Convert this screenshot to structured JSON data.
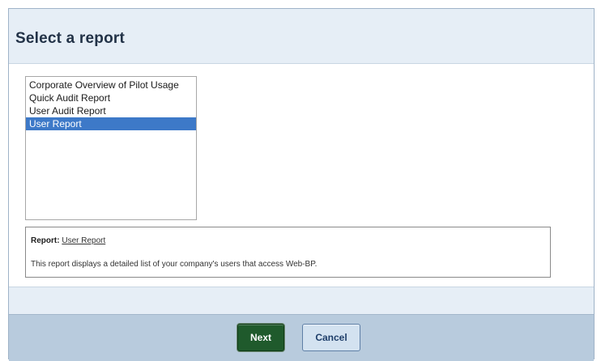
{
  "dialog": {
    "title": "Select a report"
  },
  "reports": {
    "items": [
      {
        "label": "Corporate Overview of Pilot Usage",
        "selected": false
      },
      {
        "label": "Quick Audit Report",
        "selected": false
      },
      {
        "label": "User Audit Report",
        "selected": false
      },
      {
        "label": "User Report",
        "selected": true
      }
    ],
    "selected_color": "#3d79c8"
  },
  "details": {
    "report_key": "Report:",
    "report_name": "User Report",
    "description": "This report displays a detailed list of your company's users that access Web-BP."
  },
  "footer": {
    "next_label": "Next",
    "cancel_label": "Cancel",
    "next_color": "#1f5a2c",
    "cancel_color": "#d3e2f0"
  }
}
